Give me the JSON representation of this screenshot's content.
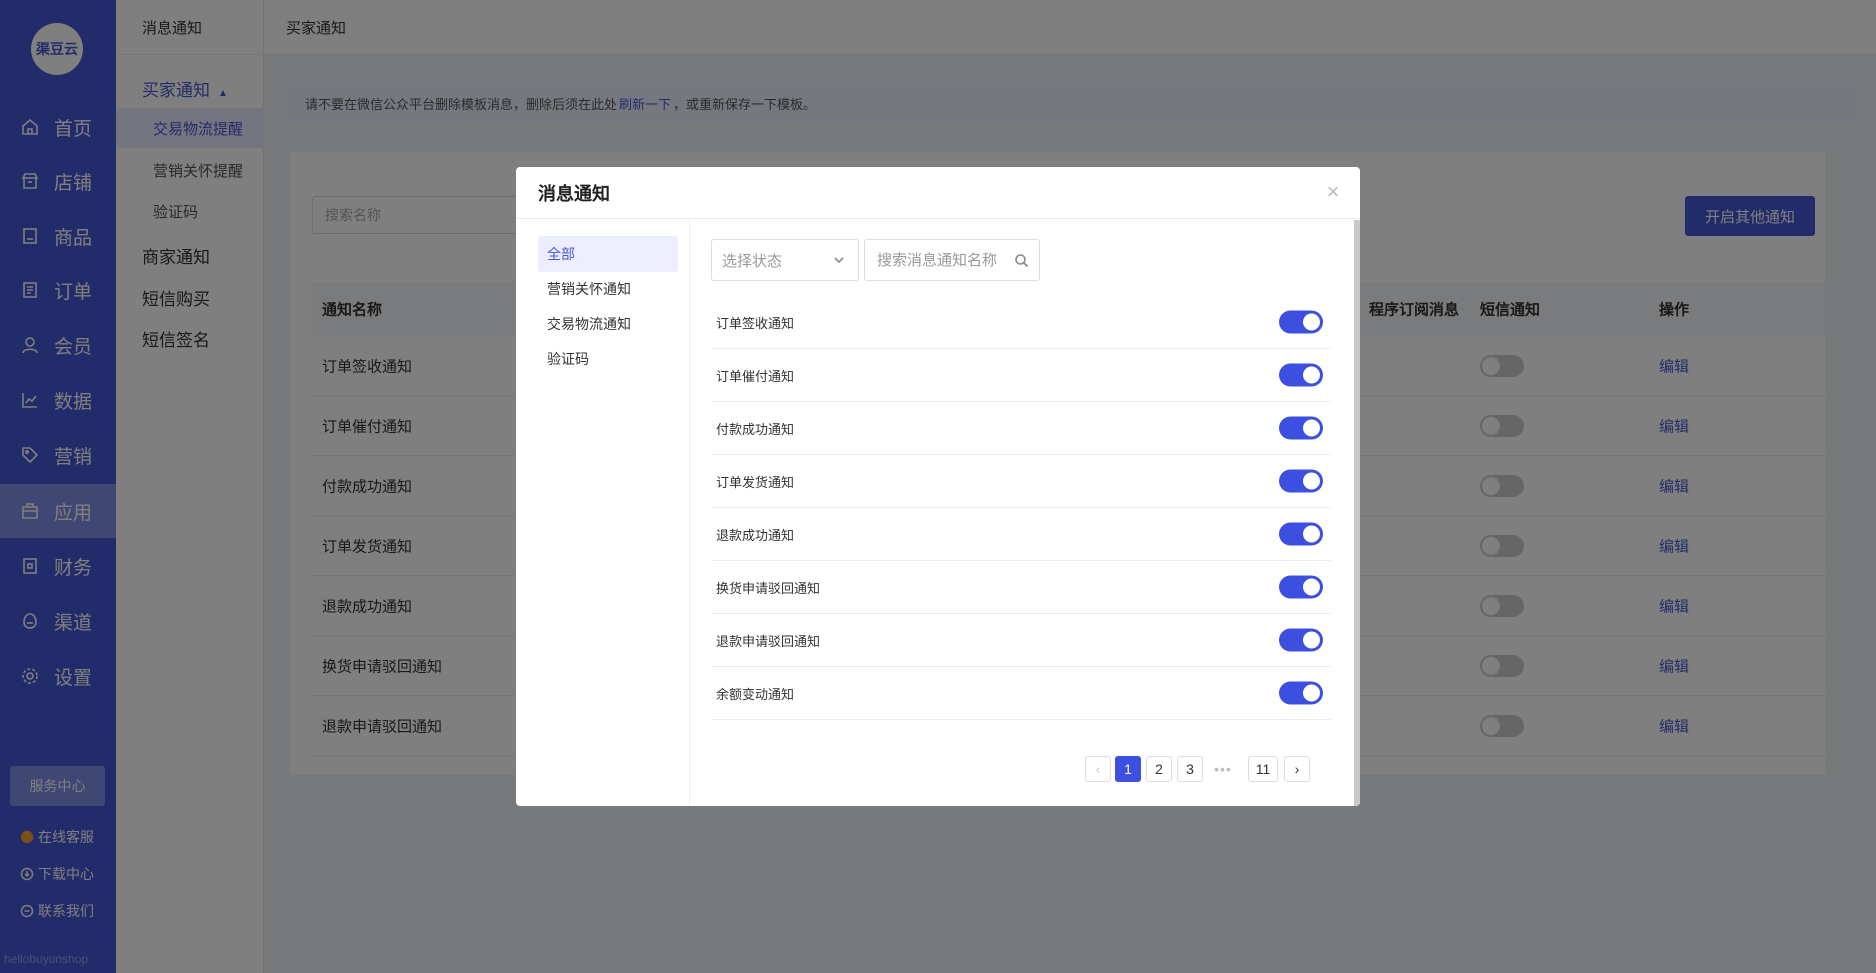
{
  "nav": {
    "logo": "渠豆云",
    "items": [
      {
        "label": "首页",
        "icon": "home-icon"
      },
      {
        "label": "店铺",
        "icon": "store-icon"
      },
      {
        "label": "商品",
        "icon": "goods-icon"
      },
      {
        "label": "订单",
        "icon": "order-icon"
      },
      {
        "label": "会员",
        "icon": "member-icon"
      },
      {
        "label": "数据",
        "icon": "chart-icon"
      },
      {
        "label": "营销",
        "icon": "tag-icon"
      },
      {
        "label": "应用",
        "icon": "app-icon"
      },
      {
        "label": "财务",
        "icon": "finance-icon"
      },
      {
        "label": "渠道",
        "icon": "channel-icon"
      },
      {
        "label": "设置",
        "icon": "gear-icon"
      }
    ],
    "active": "应用",
    "service_center": "服务中心",
    "links": [
      {
        "label": "在线客服",
        "icon": "chat-icon"
      },
      {
        "label": "下载中心",
        "icon": "download-icon"
      },
      {
        "label": "联系我们",
        "icon": "contact-icon"
      }
    ],
    "footer": "hellobuyunshop"
  },
  "subnav": {
    "title": "消息通知",
    "group_buyer": "买家通知",
    "buyer_items": [
      "交易物流提醒",
      "营销关怀提醒",
      "验证码"
    ],
    "groups": [
      "商家通知",
      "短信购买",
      "短信签名"
    ]
  },
  "main": {
    "breadcrumb": "买家通知",
    "notice_pre": "请不要在微信公众平台删除模板消息，删除后须在此处",
    "notice_link": "刷新一下",
    "notice_post": "，或重新保存一下模板。",
    "search_placeholder": "搜索名称",
    "open_button": "开启其他通知",
    "columns": {
      "name": "通知名称",
      "mini": "程序订阅消息",
      "sms": "短信通知",
      "action": "操作"
    },
    "rows": [
      "订单签收通知",
      "订单催付通知",
      "付款成功通知",
      "订单发货通知",
      "退款成功通知",
      "换货申请驳回通知",
      "退款申请驳回通知"
    ],
    "edit_label": "编辑"
  },
  "modal": {
    "title": "消息通知",
    "close": "×",
    "categories": [
      "全部",
      "营销关怀通知",
      "交易物流通知",
      "验证码"
    ],
    "status_placeholder": "选择状态",
    "search_placeholder": "搜索消息通知名称",
    "messages": [
      {
        "name": "订单签收通知",
        "enabled": true
      },
      {
        "name": "订单催付通知",
        "enabled": true
      },
      {
        "name": "付款成功通知",
        "enabled": true
      },
      {
        "name": "订单发货通知",
        "enabled": true
      },
      {
        "name": "退款成功通知",
        "enabled": true
      },
      {
        "name": "换货申请驳回通知",
        "enabled": true
      },
      {
        "name": "退款申请驳回通知",
        "enabled": true
      },
      {
        "name": "余额变动通知",
        "enabled": true
      }
    ],
    "pagination": {
      "prev": "‹",
      "pages": [
        "1",
        "2",
        "3"
      ],
      "ellipsis": "•••",
      "last": "11",
      "next": "›",
      "current": "1"
    }
  },
  "colors": {
    "primary": "#4759d4",
    "toggle_on": "#3d4fe0"
  }
}
